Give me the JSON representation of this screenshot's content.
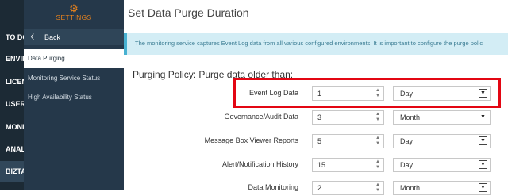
{
  "mainnav": {
    "items": [
      {
        "label": "TO DO",
        "active": false
      },
      {
        "label": "ENVIR",
        "active": false
      },
      {
        "label": "LICEN",
        "active": false
      },
      {
        "label": "USER",
        "active": false
      },
      {
        "label": "MONI",
        "active": false
      },
      {
        "label": "ANALY",
        "active": false
      },
      {
        "label": "BIZTA",
        "active": true
      }
    ]
  },
  "settings": {
    "gear_icon": "gear-icon",
    "title": "SETTINGS",
    "back_label": "Back",
    "items": [
      {
        "label": "Data Purging",
        "active": true
      },
      {
        "label": "Monitoring Service Status",
        "active": false
      },
      {
        "label": "High Availability Status",
        "active": false
      }
    ]
  },
  "page": {
    "title": "Set Data Purge Duration",
    "info": "The monitoring service captures Event Log data from all various configured environments. It is important to configure the purge polic",
    "policy_heading": "Purging Policy: Purge data older than:"
  },
  "rows": [
    {
      "label": "Event Log Data",
      "value": "1",
      "unit": "Day",
      "highlighted": true
    },
    {
      "label": "Governance/Audit Data",
      "value": "3",
      "unit": "Month"
    },
    {
      "label": "Message Box Viewer Reports",
      "value": "5",
      "unit": "Day"
    },
    {
      "label": "Alert/Notification History",
      "value": "15",
      "unit": "Day"
    },
    {
      "label": "Data Monitoring",
      "value": "2",
      "unit": "Month"
    }
  ],
  "colors": {
    "highlight_border": "#e30613",
    "sidebar_bg": "#25384a",
    "accent": "#e8831d",
    "info_bg": "#d3edf5"
  }
}
